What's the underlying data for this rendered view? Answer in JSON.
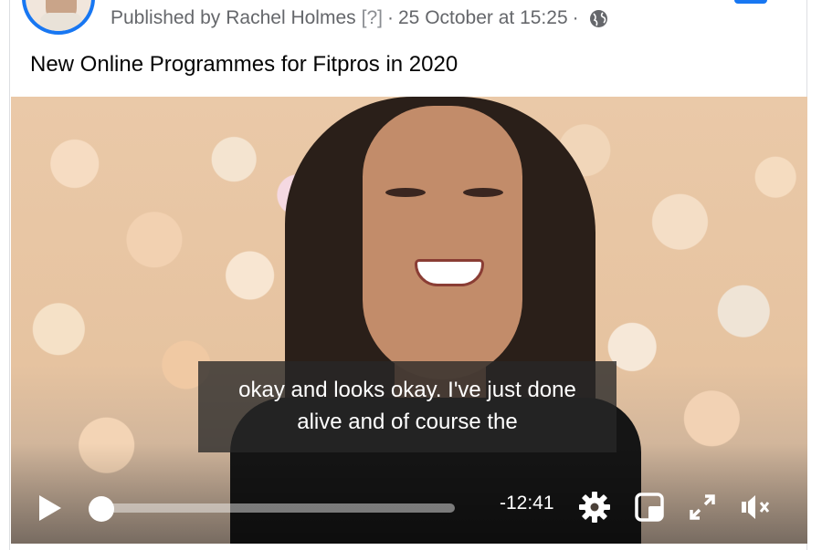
{
  "post": {
    "published_prefix": "Published by",
    "author": "Rachel Holmes",
    "help_marker": "[?]",
    "separator": "·",
    "date": "25 October at 15:25",
    "title": "New Online Programmes for Fitpros in 2020"
  },
  "video": {
    "caption_line1": "okay and looks okay. I've just done",
    "caption_line2": "alive and of course the",
    "time_remaining": "-12:41",
    "progress_fraction": 0.0
  },
  "icons": {
    "avatar": "avatar",
    "audience": "globe-icon",
    "play": "play-icon",
    "settings": "gear-icon",
    "pip": "picture-in-picture-icon",
    "fullscreen": "expand-icon",
    "mute": "volume-muted-icon"
  },
  "colors": {
    "accent": "#1877f2",
    "meta_text": "#65676b",
    "title_text": "#050505",
    "control_white": "#ffffff"
  }
}
